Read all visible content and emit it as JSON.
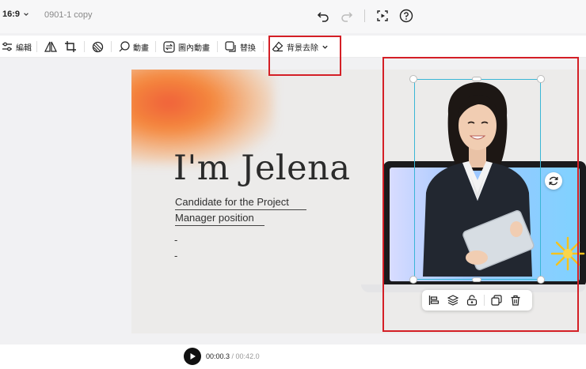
{
  "topbar": {
    "ratio": "16:9",
    "doc_title": "0901-1 copy"
  },
  "toolbar": {
    "edit": "編輯",
    "animation": "動畫",
    "inner_animation": "圖內動畫",
    "replace": "替換",
    "remove_bg": "背景去除"
  },
  "slide": {
    "name": "I'm Jelena",
    "subtitle_line1": "Candidate for the Project",
    "subtitle_line2": "Manager position",
    "dash1": "-",
    "dash2": "-"
  },
  "player": {
    "current": "00:00.3",
    "separator": " / ",
    "total": "00:42.0"
  },
  "colors": {
    "annotation_red": "#d41f26",
    "selection_blue": "#3ab6d6"
  }
}
